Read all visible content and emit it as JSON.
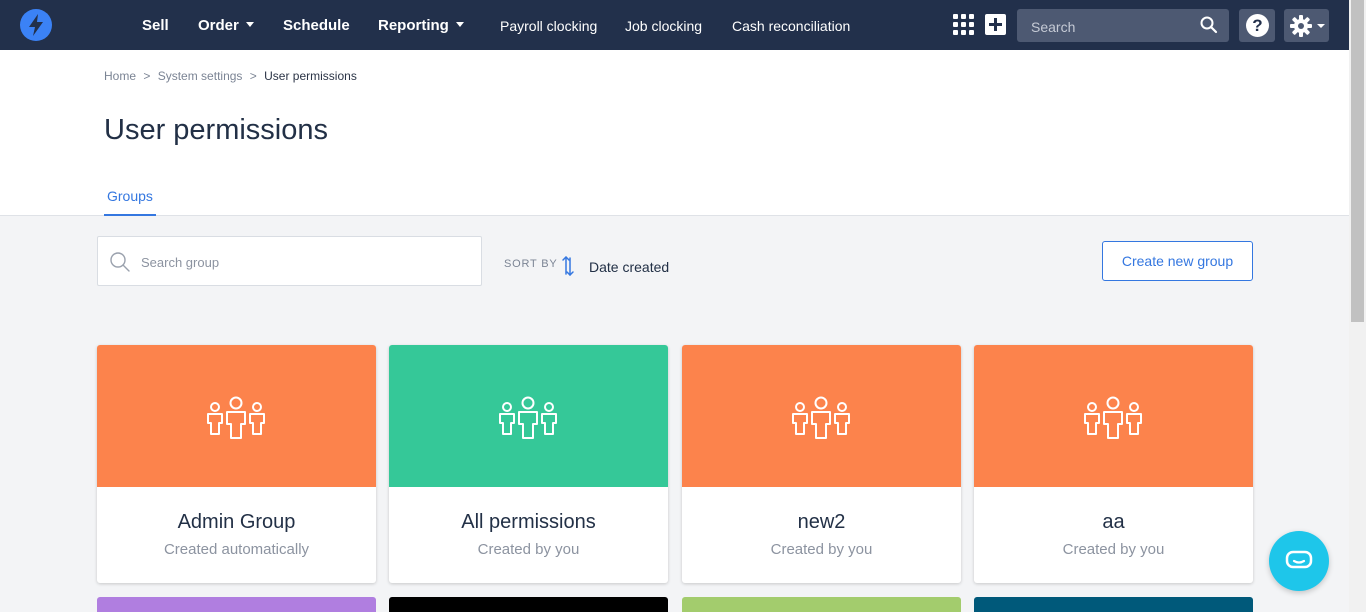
{
  "nav": {
    "items": [
      {
        "label": "Sell",
        "dropdown": false
      },
      {
        "label": "Order",
        "dropdown": true
      },
      {
        "label": "Schedule",
        "dropdown": false
      },
      {
        "label": "Reporting",
        "dropdown": true
      },
      {
        "label": "Payroll clocking",
        "dropdown": false
      },
      {
        "label": "Job clocking",
        "dropdown": false
      },
      {
        "label": "Cash reconciliation",
        "dropdown": false
      }
    ],
    "search_placeholder": "Search",
    "help_label": "?"
  },
  "breadcrumb": {
    "items": [
      "Home",
      "System settings"
    ],
    "current": "User permissions",
    "separator": ">"
  },
  "page_title": "User permissions",
  "tabs": [
    {
      "label": "Groups",
      "active": true
    }
  ],
  "toolbar": {
    "search_placeholder": "Search group",
    "sort_label": "SORT BY",
    "sort_value": "Date created",
    "create_button": "Create new group"
  },
  "groups": [
    {
      "name": "Admin Group",
      "subtitle": "Created automatically",
      "color": "#fc834c"
    },
    {
      "name": "All permissions",
      "subtitle": "Created by you",
      "color": "#35c898"
    },
    {
      "name": "new2",
      "subtitle": "Created by you",
      "color": "#fc834c"
    },
    {
      "name": "aa",
      "subtitle": "Created by you",
      "color": "#fc834c"
    }
  ],
  "groups_next_row_colors": [
    "#b07ee0",
    "#000000",
    "#a3cc6d",
    "#00597a"
  ],
  "colors": {
    "nav_bg": "#22304b",
    "accent": "#3477e0",
    "chat": "#1ec6ea"
  }
}
